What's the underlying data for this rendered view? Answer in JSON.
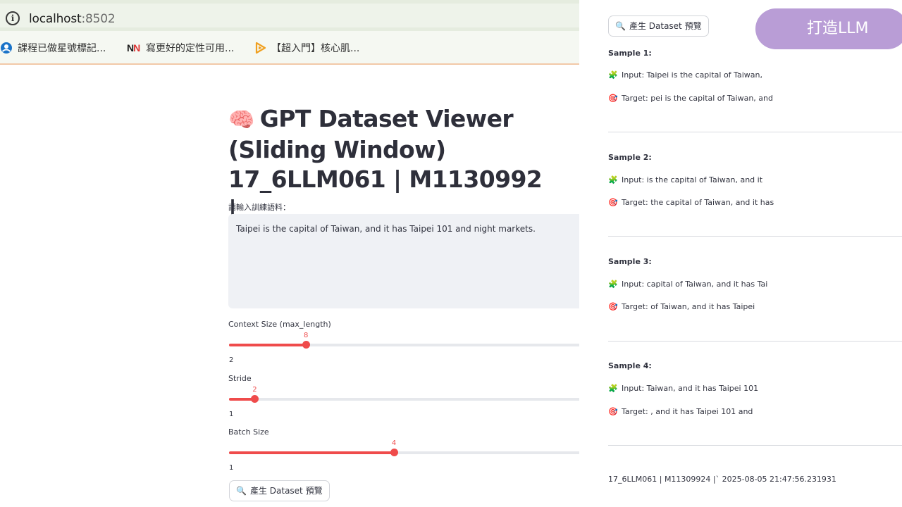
{
  "browser": {
    "url_host": "localhost",
    "url_port": ":8502",
    "bookmarks": [
      {
        "label": "課程已做星號標記...",
        "icon": "globe-user-icon"
      },
      {
        "label": "寫更好的定性可用...",
        "icon": "nn-logo-icon"
      },
      {
        "label": "【超入門】核心肌...",
        "icon": "play-icon"
      }
    ]
  },
  "app": {
    "title_emoji": "🧠",
    "title": "GPT Dataset Viewer (Sliding Window) 17_6LLM061 | M1130992",
    "title_cursor": "|",
    "input_label": "請輸入訓練語料：",
    "input_value": "Taipei is the capital of Taiwan, and it has Taipei 101 and night markets.",
    "sliders": [
      {
        "label": "Context Size (max_length)",
        "value": "8",
        "min": "2",
        "fraction": 0.21
      },
      {
        "label": "Stride",
        "value": "2",
        "min": "1",
        "fraction": 0.07
      },
      {
        "label": "Batch Size",
        "value": "4",
        "min": "1",
        "fraction": 0.45
      }
    ],
    "button_icon": "🔍",
    "button_label": "產生 Dataset 預覽"
  },
  "results": {
    "button_icon": "🔍",
    "button_label": "產生 Dataset 預覽",
    "badge": "打造LLM",
    "input_emoji": "🧩",
    "target_emoji": "🎯",
    "samples": [
      {
        "title": "Sample 1:",
        "input": "Input: Taipei is the capital of Taiwan,",
        "target": "Target: pei is the capital of Taiwan, and"
      },
      {
        "title": "Sample 2:",
        "input": "Input: is the capital of Taiwan, and it",
        "target": "Target: the capital of Taiwan, and it has"
      },
      {
        "title": "Sample 3:",
        "input": "Input: capital of Taiwan, and it has Tai",
        "target": "Target: of Taiwan, and it has Taipei"
      },
      {
        "title": "Sample 4:",
        "input": "Input: Taiwan, and it has Taipei 101",
        "target": "Target: , and it has Taipei 101 and"
      }
    ],
    "footer": "17_6LLM061 | M11309924 |` 2025-08-05 21:47:56.231931"
  },
  "colors": {
    "accent": "#ef4b4b",
    "badge_bg": "#b99dd6",
    "address_bar_bg": "#e5ecdf"
  }
}
